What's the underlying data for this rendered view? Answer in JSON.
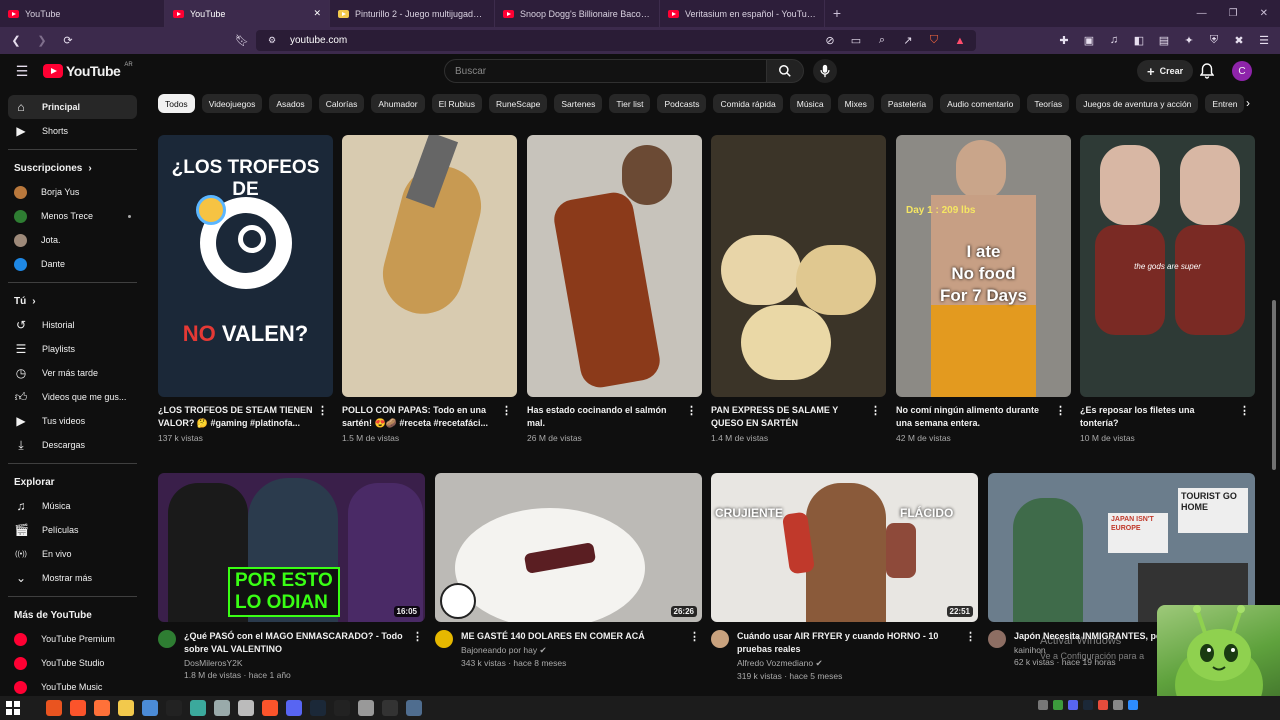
{
  "browser": {
    "tabs": [
      {
        "title": "YouTube",
        "active": false
      },
      {
        "title": "YouTube",
        "active": true
      },
      {
        "title": "Pinturillo 2 - Juego multijugador onli",
        "active": false
      },
      {
        "title": "Snoop Dogg's Billionaire Bacon - Yo",
        "active": false
      },
      {
        "title": "Veritasium en español - YouTube",
        "active": false
      }
    ],
    "new_tab": "+",
    "url": "youtube.com"
  },
  "youtube": {
    "logo_text": "YouTube",
    "region": "AR",
    "search_placeholder": "Buscar",
    "create_label": "Crear",
    "avatar_letter": "C",
    "accent": "#ff0033"
  },
  "sidebar": {
    "main": [
      {
        "label": "Principal",
        "icon": "home-icon",
        "active": true
      },
      {
        "label": "Shorts",
        "icon": "shorts-icon",
        "active": false
      }
    ],
    "subs_heading": "Suscripciones",
    "subs": [
      {
        "label": "Borja Yus",
        "color": "#b9783c"
      },
      {
        "label": "Menos Trece",
        "color": "#2e7d32",
        "new": true
      },
      {
        "label": "Jota.",
        "color": "#9e8a7a"
      },
      {
        "label": "Dante",
        "color": "#1e88e5"
      }
    ],
    "you_heading": "Tú",
    "you": [
      {
        "label": "Historial",
        "icon": "history-icon"
      },
      {
        "label": "Playlists",
        "icon": "playlist-icon"
      },
      {
        "label": "Ver más tarde",
        "icon": "clock-icon"
      },
      {
        "label": "Videos que me gus...",
        "icon": "like-icon"
      },
      {
        "label": "Tus videos",
        "icon": "video-icon"
      },
      {
        "label": "Descargas",
        "icon": "download-icon"
      }
    ],
    "explore_heading": "Explorar",
    "explore": [
      {
        "label": "Música",
        "icon": "music-icon"
      },
      {
        "label": "Películas",
        "icon": "film-icon"
      },
      {
        "label": "En vivo",
        "icon": "live-icon"
      },
      {
        "label": "Mostrar más",
        "icon": "chevron-down-icon"
      }
    ],
    "more_heading": "Más de YouTube",
    "more": [
      {
        "label": "YouTube Premium"
      },
      {
        "label": "YouTube Studio"
      },
      {
        "label": "YouTube Music"
      }
    ]
  },
  "chips": [
    "Todos",
    "Videojuegos",
    "Asados",
    "Calorías",
    "Ahumador",
    "El Rubius",
    "RuneScape",
    "Sartenes",
    "Tier list",
    "Podcasts",
    "Comida rápida",
    "Música",
    "Mixes",
    "Pastelería",
    "Audio comentario",
    "Teorías",
    "Juegos de aventura y acción",
    "Entren"
  ],
  "shorts": [
    {
      "title": "¿LOS TROFEOS DE STEAM TIENEN VALOR? 🤔 #gaming #platinofa...",
      "views": "137 k vistas",
      "overlay_top": "¿LOS TROFEOS DE",
      "overlay_no": "NO",
      "overlay_bottom": "VALEN?",
      "bg": "#1b2838"
    },
    {
      "title": "POLLO CON PAPAS: Todo en una sartén! 😍🥔 #receta #recetafáci...",
      "views": "1.5 M de vistas",
      "bg": "#d8cbb0"
    },
    {
      "title": "Has estado cocinando el salmón mal.",
      "views": "26 M de vistas",
      "bg": "#c7c3bb"
    },
    {
      "title": "PAN EXPRESS DE SALAME Y QUESO EN SARTÉN",
      "views": "1.4 M de vistas",
      "bg": "#3b3428"
    },
    {
      "title": "No comí ningún alimento durante una semana entera.",
      "views": "42 M de vistas",
      "overlay_day": "Day 1 : 209 lbs",
      "overlay_main": "I ate\nNo food\nFor 7 Days",
      "bg": "#8c8a85"
    },
    {
      "title": "¿Es reposar los filetes una tontería?",
      "views": "10 M de vistas",
      "overlay_small": "the gods are super",
      "bg": "#2e3a36"
    }
  ],
  "videos": [
    {
      "title": "¿Qué PASÓ con el MAGO ENMASCARADO? - Todo sobre VAL VALENTINO",
      "channel": "DosMilerosY2K",
      "verified": false,
      "stats": "1.8 M de vistas · hace 1 año",
      "duration": "16:05",
      "overlay": "POR ESTO\nLO ODIAN",
      "bg": "#3a1f4a",
      "avatar": "#2e7d32"
    },
    {
      "title": "ME GASTÉ 140 DOLARES EN COMER ACÁ",
      "channel": "Bajoneando por hay",
      "verified": true,
      "stats": "343 k vistas · hace 8 meses",
      "duration": "26:26",
      "bg": "#bcbab6",
      "avatar": "#e6b800"
    },
    {
      "title": "Cuándo usar AIR FRYER y cuando HORNO - 10 pruebas reales",
      "channel": "Alfredo Vozmediano",
      "verified": true,
      "stats": "319 k vistas · hace 5 meses",
      "duration": "22:51",
      "overlay_left": "CRUJIENTE",
      "overlay_right": "FLÁCIDO",
      "bg": "#e8e6e2",
      "avatar": "#c9a27e"
    },
    {
      "title": "Japón Necesita INMIGRANTES, pero quiere...",
      "channel": "kainihon",
      "verified": false,
      "stats": "62 k vistas · hace 19 horas",
      "duration": "",
      "overlay_sign1": "JAPAN ISN'T EUROPE",
      "overlay_sign2": "TOURIST GO HOME",
      "bg": "#6b7d8c",
      "avatar": "#8d6e63"
    }
  ],
  "watermark": {
    "line1": "Activar Windows",
    "line2": "Ve a Configuración para a"
  }
}
